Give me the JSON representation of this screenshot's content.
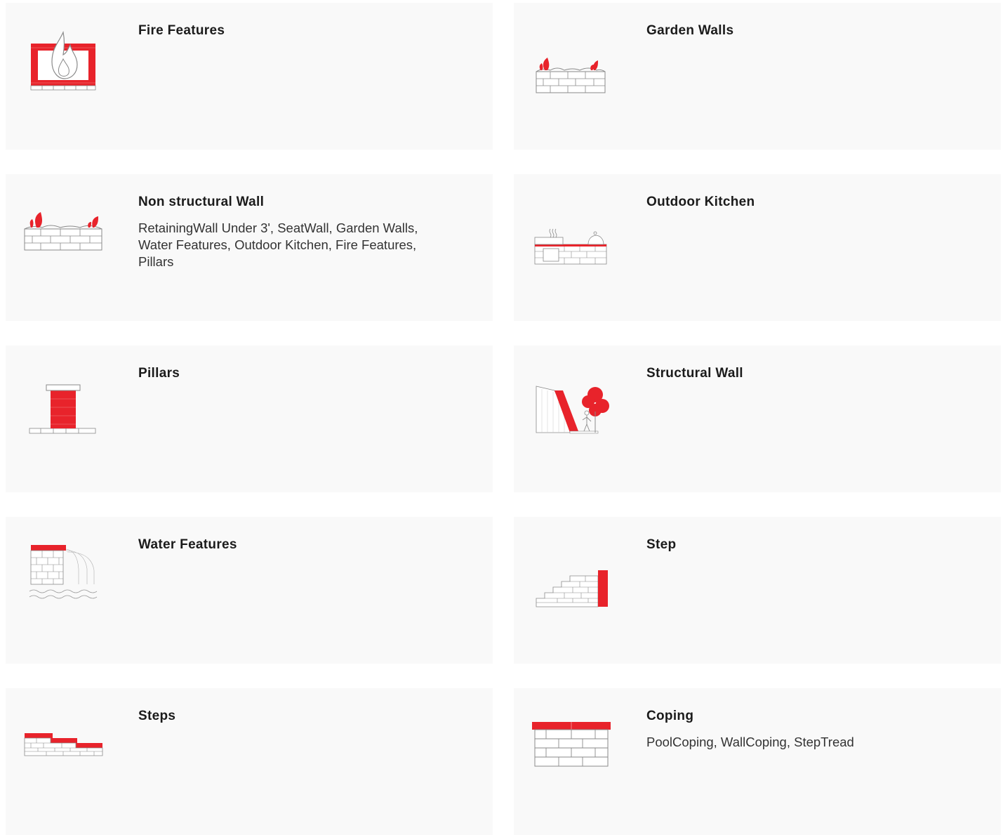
{
  "categories": [
    {
      "title": "Fire Features",
      "desc": "",
      "icon": "fire-feature-icon"
    },
    {
      "title": "Garden Walls",
      "desc": "",
      "icon": "garden-wall-icon"
    },
    {
      "title": "Non structural Wall",
      "desc": "RetainingWall Under 3', SeatWall, Garden Walls, Water Features, Outdoor Kitchen, Fire Features, Pillars",
      "icon": "non-structural-wall-icon"
    },
    {
      "title": "Outdoor Kitchen",
      "desc": "",
      "icon": "outdoor-kitchen-icon"
    },
    {
      "title": "Pillars",
      "desc": "",
      "icon": "pillar-icon"
    },
    {
      "title": "Structural Wall",
      "desc": "",
      "icon": "structural-wall-icon"
    },
    {
      "title": "Water Features",
      "desc": "",
      "icon": "water-feature-icon"
    },
    {
      "title": "Step",
      "desc": "",
      "icon": "step-icon"
    },
    {
      "title": "Steps",
      "desc": "",
      "icon": "steps-icon"
    },
    {
      "title": "Coping",
      "desc": "PoolCoping, WallCoping, StepTread",
      "icon": "coping-icon"
    }
  ],
  "colors": {
    "accent": "#e8232b",
    "line": "#8a8a8a",
    "card_bg": "#f9f9f9"
  }
}
